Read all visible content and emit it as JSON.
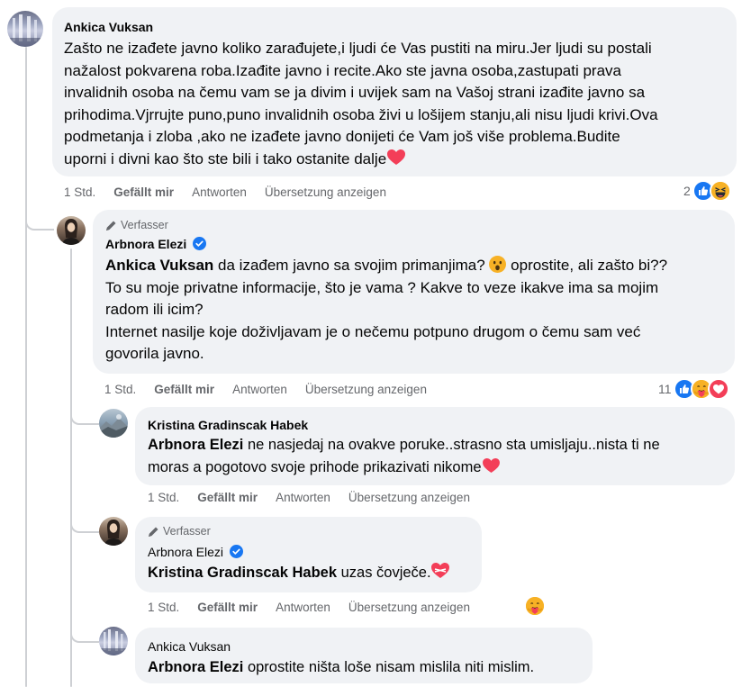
{
  "comments": [
    {
      "name": "Ankica Vuksan",
      "text_lines": [
        "Zašto ne izađete javno koliko zarađujete,i ljudi će Vas pustiti na miru.Jer ljudi su postali",
        "nažalost pokvarena roba.Izađite javno i recite.Ako ste javna osoba,zastupati prava",
        "invalidnih osoba na čemu vam se ja divim i uvijek sam na Vašoj strani izađite javno sa",
        "prihodima.Vjrrujte puno,puno invalidnih osoba živi u lošijem stanju,ali nisu ljudi krivi.Ova",
        "podmetanja i zloba ,ako ne izađete javno donijeti će Vam još više problema.Budite",
        "uporni i divni kao što ste bili i tako ostanite dalje"
      ],
      "time": "1 Std.",
      "like": "Gefällt mir",
      "reply": "Antworten",
      "translate": "Übersetzung anzeigen",
      "reaction_count": "2"
    },
    {
      "author_tag": "Verfasser",
      "name": "Arbnora Elezi",
      "mention": "Ankica Vuksan",
      "line1_rest": " da izađem javno sa svojim primanjima? ",
      "line1_end": " oprostite, ali zašto bi??",
      "text_lines": [
        "To su moje privatne informacije, što je vama ? Kakve to veze ikakve ima sa mojim",
        "radom ili icim?",
        "Internet nasilje koje doživljavam je o nečemu potpuno drugom o čemu sam već",
        "govorila javno."
      ],
      "time": "1 Std.",
      "like": "Gefällt mir",
      "reply": "Antworten",
      "translate": "Übersetzung anzeigen",
      "reaction_count": "11"
    },
    {
      "name": "Kristina Gradinscak Habek",
      "mention": "Arbnora Elezi",
      "line1_rest": " ne nasjedaj na ovakve poruke..strasno sta umisljaju..nista ti ne",
      "line2": "moras a pogotovo svoje prihode prikazivati nikome",
      "time": "1 Std.",
      "like": "Gefällt mir",
      "reply": "Antworten",
      "translate": "Übersetzung anzeigen"
    },
    {
      "author_tag": "Verfasser",
      "name": "Arbnora Elezi",
      "mention": "Kristina Gradinscak Habek",
      "text_rest": " uzas čovječe.",
      "time": "1 Std.",
      "like": "Gefällt mir",
      "reply": "Antworten",
      "translate": "Übersetzung anzeigen"
    },
    {
      "name": "Ankica Vuksan",
      "mention": "Arbnora Elezi",
      "text_rest": " oprostite ništa loše nisam mislila niti mislim."
    }
  ],
  "colors": {
    "bubble": "#f0f2f5",
    "meta": "#65676b",
    "like_blue": "#1877f2",
    "heart_red": "#f33e58",
    "care_yellow": "#f7b125",
    "thread_line": "#ced0d4"
  },
  "icons": {
    "author": "pencil-icon",
    "verified": "verified-badge-icon",
    "like": "like-reaction-icon",
    "haha": "haha-reaction-icon",
    "care": "care-reaction-icon",
    "love": "love-reaction-icon",
    "heart": "red-heart-emoji",
    "surprised": "surprised-face-emoji"
  }
}
